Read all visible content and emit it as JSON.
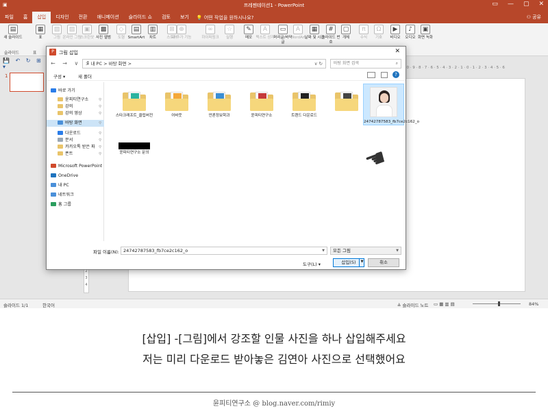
{
  "window": {
    "title": "프레젠테이션1 - PowerPoint",
    "quick_access": "💾 ↶ ↻ ⊞ ▾"
  },
  "ribbon_tabs": [
    "파일",
    "홈",
    "삽입",
    "디자인",
    "전환",
    "애니메이션",
    "슬라이드 쇼",
    "검토",
    "보기"
  ],
  "active_tab": "삽입",
  "tell_me": "어떤 작업을 원하시나요?",
  "share": "공유",
  "ribbon": {
    "buttons": [
      {
        "label": "새 슬라이드",
        "icon": "new-slide-icon",
        "dim": false
      },
      {
        "label": "표",
        "icon": "table-icon",
        "dim": false
      },
      {
        "label": "그림",
        "icon": "picture-icon",
        "dim": true
      },
      {
        "label": "온라인 그림",
        "icon": "online-picture-icon",
        "dim": true
      },
      {
        "label": "스크린샷",
        "icon": "screenshot-icon",
        "dim": true
      },
      {
        "label": "사진 앨범",
        "icon": "photo-album-icon",
        "dim": false
      },
      {
        "label": "도형",
        "icon": "shapes-icon",
        "dim": true
      },
      {
        "label": "SmartArt",
        "icon": "smartart-icon",
        "dim": false
      },
      {
        "label": "차트",
        "icon": "chart-icon",
        "dim": false
      },
      {
        "label": "스토어",
        "icon": "store-icon",
        "dim": true
      },
      {
        "label": "내 추가 기능",
        "icon": "addins-icon",
        "dim": true
      },
      {
        "label": "하이퍼링크",
        "icon": "hyperlink-icon",
        "dim": true
      },
      {
        "label": "실행",
        "icon": "action-icon",
        "dim": true
      },
      {
        "label": "메모",
        "icon": "comment-icon",
        "dim": false
      },
      {
        "label": "텍스트 상자",
        "icon": "textbox-icon",
        "dim": true
      },
      {
        "label": "머리글/바닥글",
        "icon": "header-footer-icon",
        "dim": false
      },
      {
        "label": "WordArt",
        "icon": "wordart-icon",
        "dim": true
      },
      {
        "label": "날짜 및 시간",
        "icon": "datetime-icon",
        "dim": false
      },
      {
        "label": "슬라이드 번호",
        "icon": "slide-number-icon",
        "dim": false
      },
      {
        "label": "개체",
        "icon": "object-icon",
        "dim": false
      },
      {
        "label": "수식",
        "icon": "equation-icon",
        "dim": true
      },
      {
        "label": "기호",
        "icon": "symbol-icon",
        "dim": true
      },
      {
        "label": "비디오",
        "icon": "video-icon",
        "dim": false
      },
      {
        "label": "오디오",
        "icon": "audio-icon",
        "dim": false
      },
      {
        "label": "화면 녹화",
        "icon": "screen-record-icon",
        "dim": false
      }
    ],
    "group_label_slides": "슬라이드",
    "group_label_table": "표"
  },
  "slide_pane": {
    "number": "1"
  },
  "ruler": "10 · 9 · 8 · 7 · 6 · 5 · 4 · 3 · 2 · 1 · 0 · 1 · 2 · 3 · 4 · 5 · 6",
  "status": {
    "slide": "슬라이드 1/1",
    "language": "한국어",
    "notes": "슬라이드 노트",
    "zoom": "84%"
  },
  "dialog": {
    "title": "그림 삽입",
    "address": "> 내 PC > 바탕 화면 >",
    "search_placeholder": "바탕 화면 검색",
    "organize": "구성 ▾",
    "new_folder": "새 폴더",
    "nav": [
      {
        "label": "바로 가기",
        "color": "#2b7de9",
        "pinned": false,
        "indent": 6,
        "selected": false
      },
      {
        "label": "윤피티연구소",
        "color": "#e9c46a",
        "pinned": true,
        "indent": 16,
        "selected": false
      },
      {
        "label": "강의",
        "color": "#e9c46a",
        "pinned": true,
        "indent": 16,
        "selected": false
      },
      {
        "label": "강의 영상",
        "color": "#e9c46a",
        "pinned": true,
        "indent": 16,
        "selected": false
      },
      {
        "label": "바탕 화면",
        "color": "#4a90d9",
        "pinned": true,
        "indent": 16,
        "selected": true
      },
      {
        "label": "다운로드",
        "color": "#2b7de9",
        "pinned": true,
        "indent": 16,
        "selected": false
      },
      {
        "label": "문서",
        "color": "#9aa7b4",
        "pinned": true,
        "indent": 16,
        "selected": false
      },
      {
        "label": "카카오톡 받은 파",
        "color": "#e9c46a",
        "pinned": true,
        "indent": 16,
        "selected": false
      },
      {
        "label": "폰트",
        "color": "#e9c46a",
        "pinned": true,
        "indent": 16,
        "selected": false
      },
      {
        "label": "Microsoft PowerPoint",
        "color": "#d04a2c",
        "pinned": false,
        "indent": 6,
        "selected": false
      },
      {
        "label": "OneDrive",
        "color": "#1e73be",
        "pinned": false,
        "indent": 6,
        "selected": false
      },
      {
        "label": "내 PC",
        "color": "#4a90d9",
        "pinned": false,
        "indent": 6,
        "selected": false
      },
      {
        "label": "네트워크",
        "color": "#4a90d9",
        "pinned": false,
        "indent": 6,
        "selected": false
      },
      {
        "label": "홈 그룹",
        "color": "#2b9e5f",
        "pinned": false,
        "indent": 6,
        "selected": false
      }
    ],
    "files": [
      {
        "name": "스타크래프트_클립버전",
        "strip": "#2bb3a0"
      },
      {
        "name": "어바웃",
        "strip": "#f4a83a"
      },
      {
        "name": "언론정보학과",
        "strip": "#3a8ed4"
      },
      {
        "name": "윤피티연구소",
        "strip": "#c53a3a"
      },
      {
        "name": "트렌드 다운로드",
        "strip": "#222222"
      },
      {
        "name": "",
        "strip": "#444444"
      },
      {
        "name": "24742787583_fb7ce2c162_o",
        "photo": true
      },
      {
        "name": "윤피티연구소 문의",
        "redacted": true
      }
    ],
    "filename_label": "파일 이름(N):",
    "filename_value": "24742787583_fb7ce2c162_o",
    "filetype": "모든 그림",
    "tools": "도구(L) ▾",
    "insert": "삽입(S)",
    "cancel": "취소"
  },
  "caption_line1": "[삽입] -[그림]에서 강조할 인물 사진을 하나 삽입해주세요",
  "caption_line2": "저는 미리 다운로드 받아놓은 김연아 사진으로 선택했어요",
  "footer": "윤피티연구소 @ blog.naver.com/rimiy"
}
